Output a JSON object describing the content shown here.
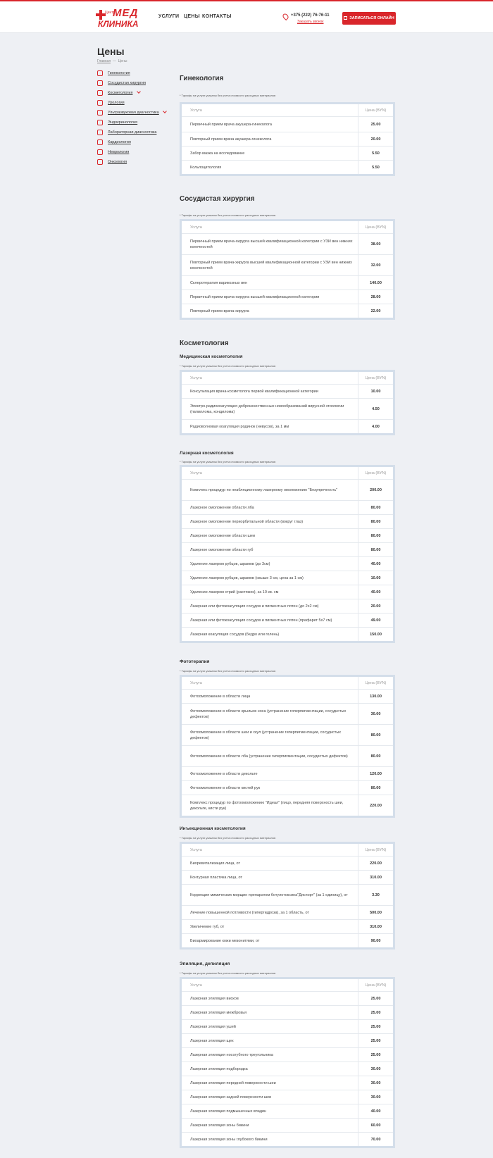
{
  "header": {
    "logo": {
      "small": "Центр",
      "top": "МЕД",
      "bottom": "КЛИНИКА"
    },
    "nav": [
      "УСЛУГИ",
      "ЦЕНЫ",
      "КОНТАКТЫ"
    ],
    "phone": "+375 (222) 76-76-11",
    "callback": "Заказать звонок",
    "cta": "ЗАПИСАТЬСЯ ОНЛАЙН",
    "accent": "#d9262b"
  },
  "page": {
    "title": "Цены",
    "breadcrumb": {
      "home": "Главная",
      "sep": "—",
      "current": "Цены"
    }
  },
  "sidebar": [
    {
      "label": "Гинекология",
      "icon": "gynecology-icon"
    },
    {
      "label": "Сосудистая хирургия",
      "icon": "vascular-surgery-icon"
    },
    {
      "label": "Косметология",
      "icon": "cosmetology-icon",
      "expandable": true
    },
    {
      "label": "Урология",
      "icon": "urology-icon"
    },
    {
      "label": "Ультразвуковая диагностика",
      "icon": "ultrasound-icon",
      "expandable": true
    },
    {
      "label": "Эндокринология",
      "icon": "endocrinology-icon"
    },
    {
      "label": "Лабораторная диагностика",
      "icon": "laboratory-icon"
    },
    {
      "label": "Кардиология",
      "icon": "cardiology-icon"
    },
    {
      "label": "Неврология",
      "icon": "neurology-icon"
    },
    {
      "label": "Онкология",
      "icon": "oncology-icon"
    }
  ],
  "table_header": {
    "name": "Услуга",
    "price": "Цена (BYN)"
  },
  "note": "* Тарифы на услуги указаны без учета стоимости расходных материалов",
  "sections": [
    {
      "title": "Гинекология"
    },
    {
      "title": "Сосудистая хирургия"
    },
    {
      "title": "Косметология"
    }
  ],
  "tables": [
    {
      "title": "Гинекология",
      "rows": [
        {
          "name": "Первичный прием врача акушера-гинеколога",
          "price": "25.00"
        },
        {
          "name": "Повторный прием врача акушера-гинеколога",
          "price": "20.00"
        },
        {
          "name": "Забор мазка на исследование",
          "price": "5.50"
        },
        {
          "name": "Кольпоцитология",
          "price": "5.50"
        }
      ]
    },
    {
      "title": "Сосудистая хирургия",
      "rows": [
        {
          "name": "Первичный прием врача-хирурга высшей квалификационной категории с УЗИ вен нижних конечностей",
          "price": "38.00"
        },
        {
          "name": "Повторный прием врача-хирурга высшей квалификационной категории с УЗИ вен нижних конечностей",
          "price": "32.00"
        },
        {
          "name": "Склеротерапия варикозных вен",
          "price": "140.00"
        },
        {
          "name": "Первичный прием врача-хирурга высшей квалификационной категории",
          "price": "28.00"
        },
        {
          "name": "Повторный прием врача-хирурга",
          "price": "22.00"
        }
      ]
    },
    {
      "title": "Медицинская косметология",
      "rows": [
        {
          "name": "Консультация врача-косметолога первой квалификационной категории",
          "price": "10.00"
        },
        {
          "name": "Электро-радиокоагуляция доброкачественных новообразований вирусной этиологии (папиллома, кондилома)",
          "price": "4.50"
        },
        {
          "name": "Радиоволновая коагуляция родинок (невусов), за 1 мм",
          "price": "4.00"
        }
      ]
    },
    {
      "title": "Лазерная косметология",
      "rows": [
        {
          "name": "Комплекс процедур по неабляционному лазерному омоложению \"Безупречность\"",
          "price": "200.00"
        },
        {
          "name": "Лазерное омоложение области лба",
          "price": "80.00"
        },
        {
          "name": "Лазерное омоложение периорбитальной области (вокруг глаз)",
          "price": "80.00"
        },
        {
          "name": "Лазерное омоложение области шеи",
          "price": "80.00"
        },
        {
          "name": "Лазерное омоложение области губ",
          "price": "80.00"
        },
        {
          "name": "Удаление лазером рубцов, шрамов (до 3см)",
          "price": "40.00"
        },
        {
          "name": "Удаление лазером рубцов, шрамов (свыше 3 см, цена за 1 см)",
          "price": "10.00"
        },
        {
          "name": "Удаление лазером стрий (растяжек), за 10 кв. см",
          "price": "40.00"
        },
        {
          "name": "Лазерная или фотокоагуляция сосудов и пигментных пятен (до 2х2 см)",
          "price": "20.00"
        },
        {
          "name": "Лазерная или фотокоагуляция сосудов и пигментных пятен (прафарет 5х7 см)",
          "price": "49.00"
        },
        {
          "name": "Лазерная коагуляция сосудов (бедро или голень)",
          "price": "150.00"
        }
      ]
    },
    {
      "title": "Фототерапия",
      "rows": [
        {
          "name": "Фотоомоложение в области лица",
          "price": "130.00"
        },
        {
          "name": "Фотоомоложение в области крыльев носа (устранение гиперпигментации, сосудистых дефектов)",
          "price": "30.00"
        },
        {
          "name": "Фотоомоложение в области шеи и скул (устранение гиперпигментации, сосудистых дефектов)",
          "price": "80.00"
        },
        {
          "name": "Фотоомоложение в области лба (устранение гиперпигментации, сосудистых дефектов)",
          "price": "80.00"
        },
        {
          "name": "Фотоомоложение в области декольте",
          "price": "120.00"
        },
        {
          "name": "Фотоомоложение в области кистей рук",
          "price": "80.00"
        },
        {
          "name": "Комплекс процедур по фотоомоложению \"Идеал\" (лицо, передняя поверхность шеи, декольте, кисти рук)",
          "price": "220.00"
        }
      ]
    },
    {
      "title": "Инъекционная косметология",
      "rows": [
        {
          "name": "Биоревитализация лица, от",
          "price": "220.00"
        },
        {
          "name": "Контурная пластика лица, от",
          "price": "310.00"
        },
        {
          "name": "Коррекция мимических морщин препаратом ботулотоксина\"Диспорт\" (за 1 единицу), от",
          "price": "3.30"
        },
        {
          "name": "Лечение повышенной потливости (гипергидроза), за 1 область, от",
          "price": "500.00"
        },
        {
          "name": "Увеличение губ, от",
          "price": "310.00"
        },
        {
          "name": "Биоармирование кожи мезонитями, от",
          "price": "90.00"
        }
      ]
    },
    {
      "title": "Эпиляция, депиляция",
      "rows": [
        {
          "name": "Лазерная эпиляция висков",
          "price": "25.00"
        },
        {
          "name": "Лазерная эпиляция межбровья",
          "price": "25.00"
        },
        {
          "name": "Лазерная эпиляция ушей",
          "price": "25.00"
        },
        {
          "name": "Лазерная эпиляция щек",
          "price": "25.00"
        },
        {
          "name": "Лазерная эпиляция носогубного треугольника",
          "price": "25.00"
        },
        {
          "name": "Лазерная эпиляция подбородка",
          "price": "30.00"
        },
        {
          "name": "Лазерная эпиляция передней поверхности шеи",
          "price": "30.00"
        },
        {
          "name": "Лазерная эпиляция задней поверхности шеи",
          "price": "30.00"
        },
        {
          "name": "Лазерная эпиляция подмышечных впадин",
          "price": "40.00"
        },
        {
          "name": "Лазерная эпиляция зоны бикини",
          "price": "60.00"
        },
        {
          "name": "Лазерная эпиляция зоны глубокого бикини",
          "price": "70.00"
        }
      ]
    }
  ]
}
